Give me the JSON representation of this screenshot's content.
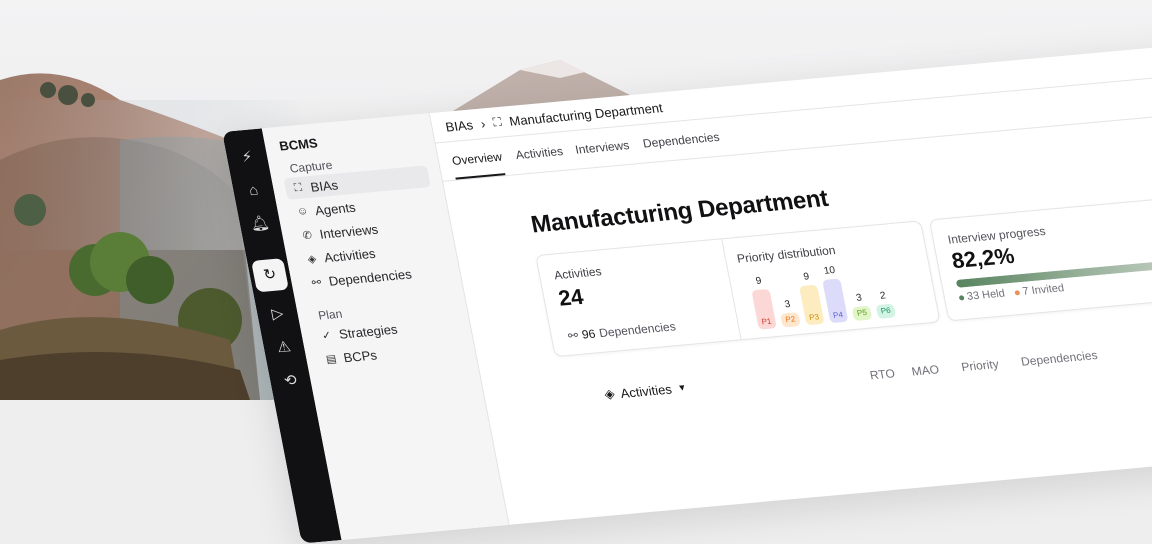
{
  "app": {
    "brand": "BCMS"
  },
  "sidebar": {
    "sections": [
      {
        "label": "Capture"
      },
      {
        "label": "Plan"
      }
    ],
    "items": [
      {
        "label": "BIAs",
        "icon": "scan-icon"
      },
      {
        "label": "Agents",
        "icon": "smiley-icon"
      },
      {
        "label": "Interviews",
        "icon": "phone-icon"
      },
      {
        "label": "Activities",
        "icon": "diamond-icon"
      },
      {
        "label": "Dependencies",
        "icon": "link-icon"
      },
      {
        "label": "Strategies",
        "icon": "check-circle-icon"
      },
      {
        "label": "BCPs",
        "icon": "clipboard-icon"
      }
    ]
  },
  "breadcrumb": {
    "root": "BIAs",
    "separator": "›",
    "current": "Manufacturing Department"
  },
  "tabs": [
    "Overview",
    "Activities",
    "Interviews",
    "Dependencies"
  ],
  "page": {
    "title": "Manufacturing Department"
  },
  "stats": {
    "activities_label": "Activities",
    "activities_value": "24",
    "dependencies_count": "96",
    "dependencies_label": "Dependencies",
    "priority_label": "Priority distribution",
    "progress_label": "Interview progress",
    "progress_value": "82,2%",
    "progress_fraction": 0.822,
    "held_label": "33 Held",
    "invited_label": "7 Invited"
  },
  "chart_data": {
    "type": "bar",
    "categories": [
      "P1",
      "P2",
      "P3",
      "P4",
      "P5",
      "P6"
    ],
    "values": [
      9,
      3,
      9,
      10,
      3,
      2
    ],
    "colors": [
      "#fbd7d5",
      "#fde6cc",
      "#fdecc0",
      "#dcdcfa",
      "#e0f5c8",
      "#d3f4e4"
    ],
    "text_colors": [
      "#d33b2c",
      "#e0761c",
      "#cc8a00",
      "#5b5bd6",
      "#5f9b18",
      "#1e9464"
    ]
  },
  "table": {
    "filter_label": "Activities",
    "columns": [
      "RTO",
      "MAO",
      "Priority",
      "Dependencies"
    ]
  },
  "colors": {
    "rail": "#111113",
    "accent": "#58845f",
    "invited": "#e8935a"
  }
}
